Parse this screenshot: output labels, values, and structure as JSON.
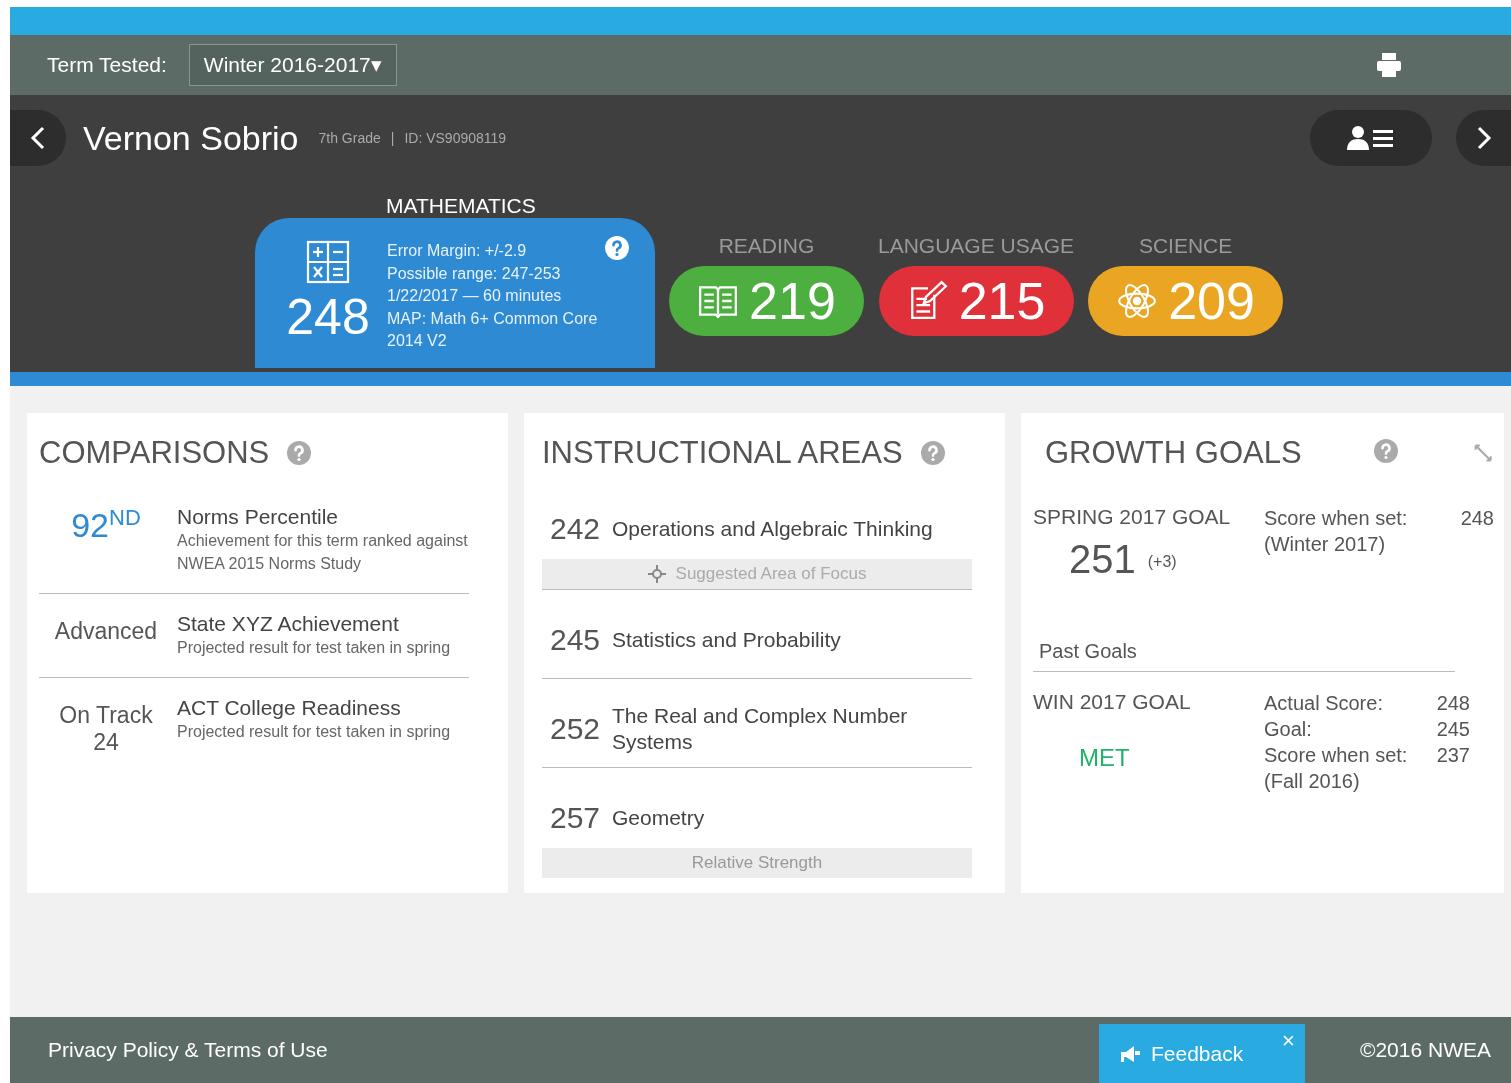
{
  "term_bar": {
    "label": "Term Tested:",
    "term_select": {
      "value": "Winter 2016-2017",
      "caret": "▾"
    }
  },
  "student": {
    "name": "Vernon Sobrio",
    "grade": "7th Grade",
    "separator": "|",
    "id": "ID: VS90908119"
  },
  "subjects": [
    {
      "kind": "math",
      "label": "MATHEMATICS",
      "score": "248",
      "selected": true,
      "details": [
        "Error Margin: +/-2.9",
        "Possible range: 247-253",
        "1/22/2017 — 60 minutes",
        "MAP: Math 6+ Common Core 2014 V2"
      ]
    },
    {
      "kind": "reading",
      "label": "READING",
      "score": "219",
      "selected": false,
      "color": "#4caf3f"
    },
    {
      "kind": "language",
      "label": "LANGUAGE USAGE",
      "score": "215",
      "selected": false,
      "color": "#e0303a"
    },
    {
      "kind": "science",
      "label": "SCIENCE",
      "score": "209",
      "selected": false,
      "color": "#eaa623"
    }
  ],
  "comparisons": {
    "title": "COMPARISONS",
    "rows": [
      {
        "kind": "percentile",
        "value": "92$^{ND}$",
        "title": "Norms Percentile",
        "description": "Achievement  for this term ranked against NWEA 2015 Norms Study"
      },
      {
        "kind": "status",
        "value": "Advanced",
        "title": "State XYZ Achievement",
        "description": "Projected result for test taken in spring"
      },
      {
        "kind": "status",
        "value": "On Track",
        "value_extra": "24",
        "title": "ACT College Readiness",
        "description": "Projected result for test taken in spring"
      }
    ]
  },
  "instructional_areas": {
    "title": "INSTRUCTIONAL AREAS",
    "rows": [
      {
        "score": "242",
        "name": "Operations and Algebraic Thinking",
        "tag": {
          "kind": "focus",
          "text": "Suggested Area of Focus"
        }
      },
      {
        "score": "245",
        "name": "Statistics and Probability"
      },
      {
        "score": "252",
        "name": "The Real and Complex Number Systems"
      },
      {
        "score": "257",
        "name": "Geometry",
        "tag": {
          "kind": "strength",
          "text": "Relative Strength"
        }
      }
    ]
  },
  "growth_goals": {
    "title": "GROWTH GOALS",
    "current": {
      "label": "SPRING 2017 GOAL",
      "score": "251",
      "change": "(+3)",
      "set_label": "Score when set:",
      "set_value": "248",
      "set_term": "(Winter 2017)"
    },
    "past_title": "Past Goals",
    "past": [
      {
        "label": "WIN 2017 GOAL",
        "status": "MET",
        "met": true,
        "lines": [
          {
            "label": "Actual Score:",
            "value": "248"
          },
          {
            "label": "Goal:",
            "value": "245"
          },
          {
            "label": "Score when set:",
            "value": "237"
          }
        ],
        "set_term": "(Fall 2016)"
      }
    ]
  },
  "footer": {
    "link": "Privacy Policy & Terms of Use",
    "feedback": "Feedback",
    "feedback_close": "×",
    "copyright": "©2016 NWEA"
  }
}
